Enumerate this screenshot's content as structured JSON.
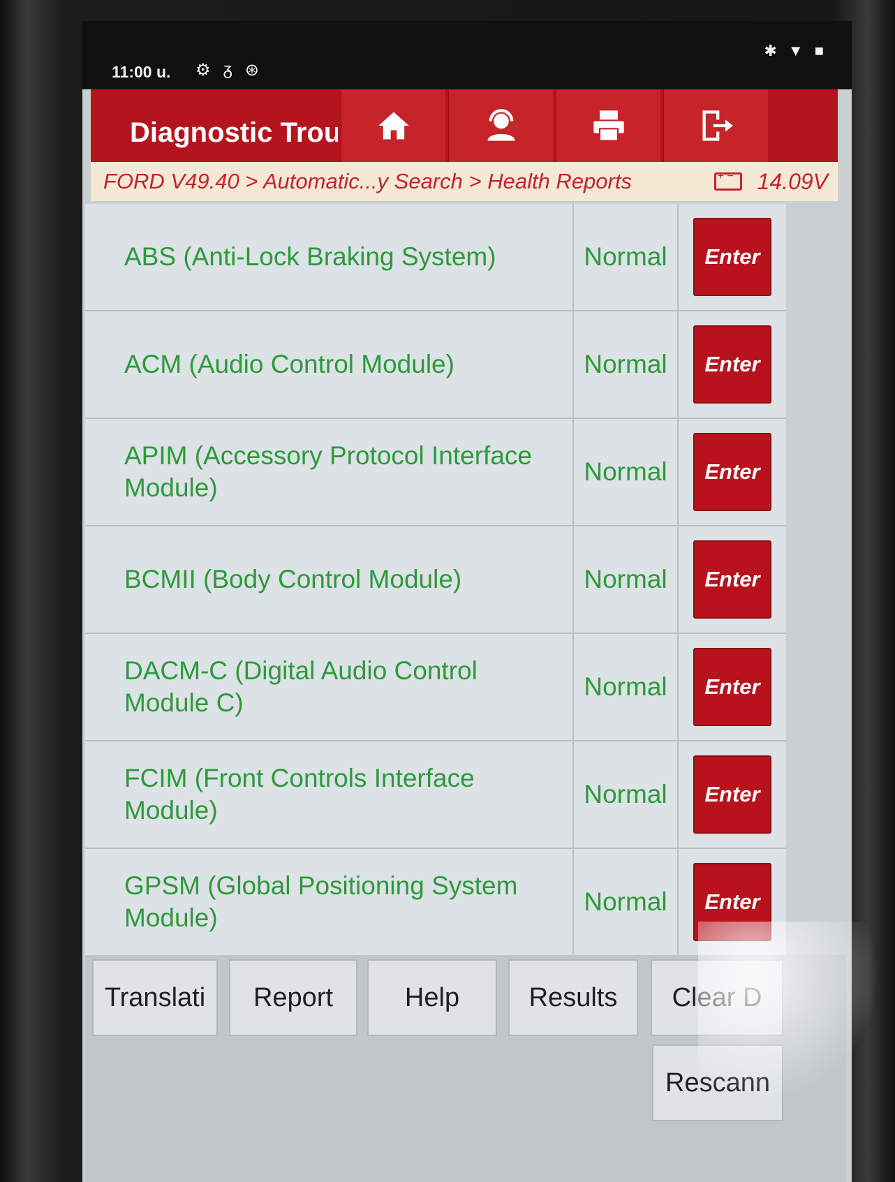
{
  "status_bar": {
    "time": "11:00 u.",
    "left_icons": [
      "gear-icon",
      "stethoscope-icon",
      "bluetooth-circle-icon"
    ],
    "right_icons": [
      "bluetooth-icon",
      "wifi-icon",
      "battery-icon"
    ]
  },
  "header": {
    "title": "Diagnostic Trou",
    "buttons": [
      {
        "icon": "home-icon"
      },
      {
        "icon": "support-agent-icon"
      },
      {
        "icon": "printer-icon"
      },
      {
        "icon": "exit-icon"
      }
    ]
  },
  "breadcrumb": {
    "path": "FORD V49.40 > Automatic...y Search > Health Reports",
    "voltage": "14.09V"
  },
  "modules": [
    {
      "name": "ABS (Anti-Lock Braking System)",
      "status": "Normal",
      "action": "Enter"
    },
    {
      "name": "ACM (Audio Control Module)",
      "status": "Normal",
      "action": "Enter"
    },
    {
      "name": "APIM (Accessory Protocol Interface Module)",
      "status": "Normal",
      "action": "Enter"
    },
    {
      "name": "BCMII (Body Control Module)",
      "status": "Normal",
      "action": "Enter"
    },
    {
      "name": "DACM-C (Digital Audio Control Module C)",
      "status": "Normal",
      "action": "Enter"
    },
    {
      "name": "FCIM (Front Controls Interface Module)",
      "status": "Normal",
      "action": "Enter"
    },
    {
      "name": "GPSM (Global Positioning System Module)",
      "status": "Normal",
      "action": "Enter"
    }
  ],
  "toolbar": {
    "translation": "Translati",
    "report": "Report",
    "help": "Help",
    "results": "Results",
    "clear_dtc": "Clear D",
    "rescan": "Rescann"
  },
  "colors": {
    "header_red": "#b5141e",
    "status_green": "#2c9a3a",
    "breadcrumb_bg": "#f5e9d6"
  }
}
